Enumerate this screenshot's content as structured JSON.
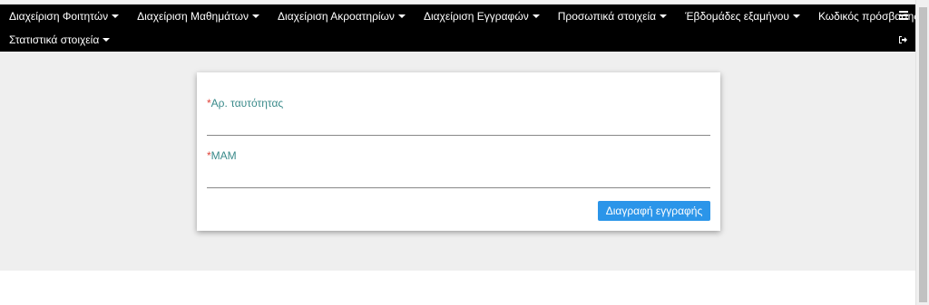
{
  "navbar": {
    "row1": [
      {
        "label": "Διαχείριση Φοιτητών"
      },
      {
        "label": "Διαχείριση Μαθημάτων"
      },
      {
        "label": "Διαχείριση Ακροατηρίων"
      },
      {
        "label": "Διαχείριση Εγγραφών"
      },
      {
        "label": "Προσωπικά στοιχεία"
      },
      {
        "label": "Έβδομάδες εξαμήνου"
      },
      {
        "label": "Κωδικός πρόσβασης"
      }
    ],
    "row2": [
      {
        "label": "Στατιστικά στοιχεία"
      }
    ],
    "icons": {
      "menu": "hamburger-icon",
      "logout": "sign-out-icon"
    },
    "background_color": "#000000",
    "text_color": "#ffffff"
  },
  "form": {
    "fields": [
      {
        "required_mark": "*",
        "label": "Αρ. ταυτότητας",
        "value": ""
      },
      {
        "required_mark": "*",
        "label": "ΜΑΜ",
        "value": ""
      }
    ],
    "submit_label": "Διαγραφή εγγραφής",
    "label_color": "#3a8a8a",
    "required_color": "#e0443a",
    "button_color": "#2b95e9"
  },
  "page": {
    "background_color": "#efefef"
  }
}
